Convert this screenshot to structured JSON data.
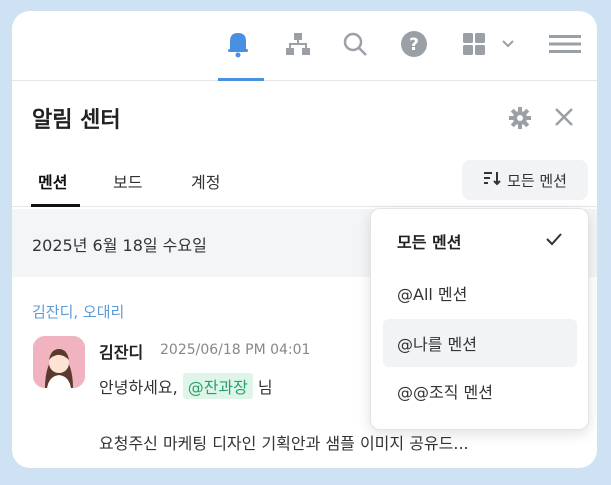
{
  "topbar": {
    "icons": [
      "bell-icon",
      "org-chart-icon",
      "search-icon",
      "help-icon",
      "apps-grid-icon",
      "chevron-down-icon",
      "menu-icon"
    ],
    "accent": "#4a90e2"
  },
  "panel": {
    "title": "알림 센터",
    "tabs": [
      "멘션",
      "보드",
      "계정"
    ],
    "sort_label": "모든 멘션"
  },
  "feed": {
    "date": "2025년 6월 18일 수요일",
    "group": "김잔디, 오대리",
    "message": {
      "sender": "김잔디",
      "timestamp": "2025/06/18 PM 04:01",
      "greeting": "안녕하세요,",
      "mention": "@잔과장",
      "honorific": "님",
      "body": "요청주신 마케팅 디자인 기획안과 샘플 이미지 공유드..."
    }
  },
  "dropdown": {
    "items": [
      "모든 멘션",
      "@All 멘션",
      "@나를 멘션",
      "@@조직 멘션"
    ],
    "selected": "모든 멘션"
  }
}
